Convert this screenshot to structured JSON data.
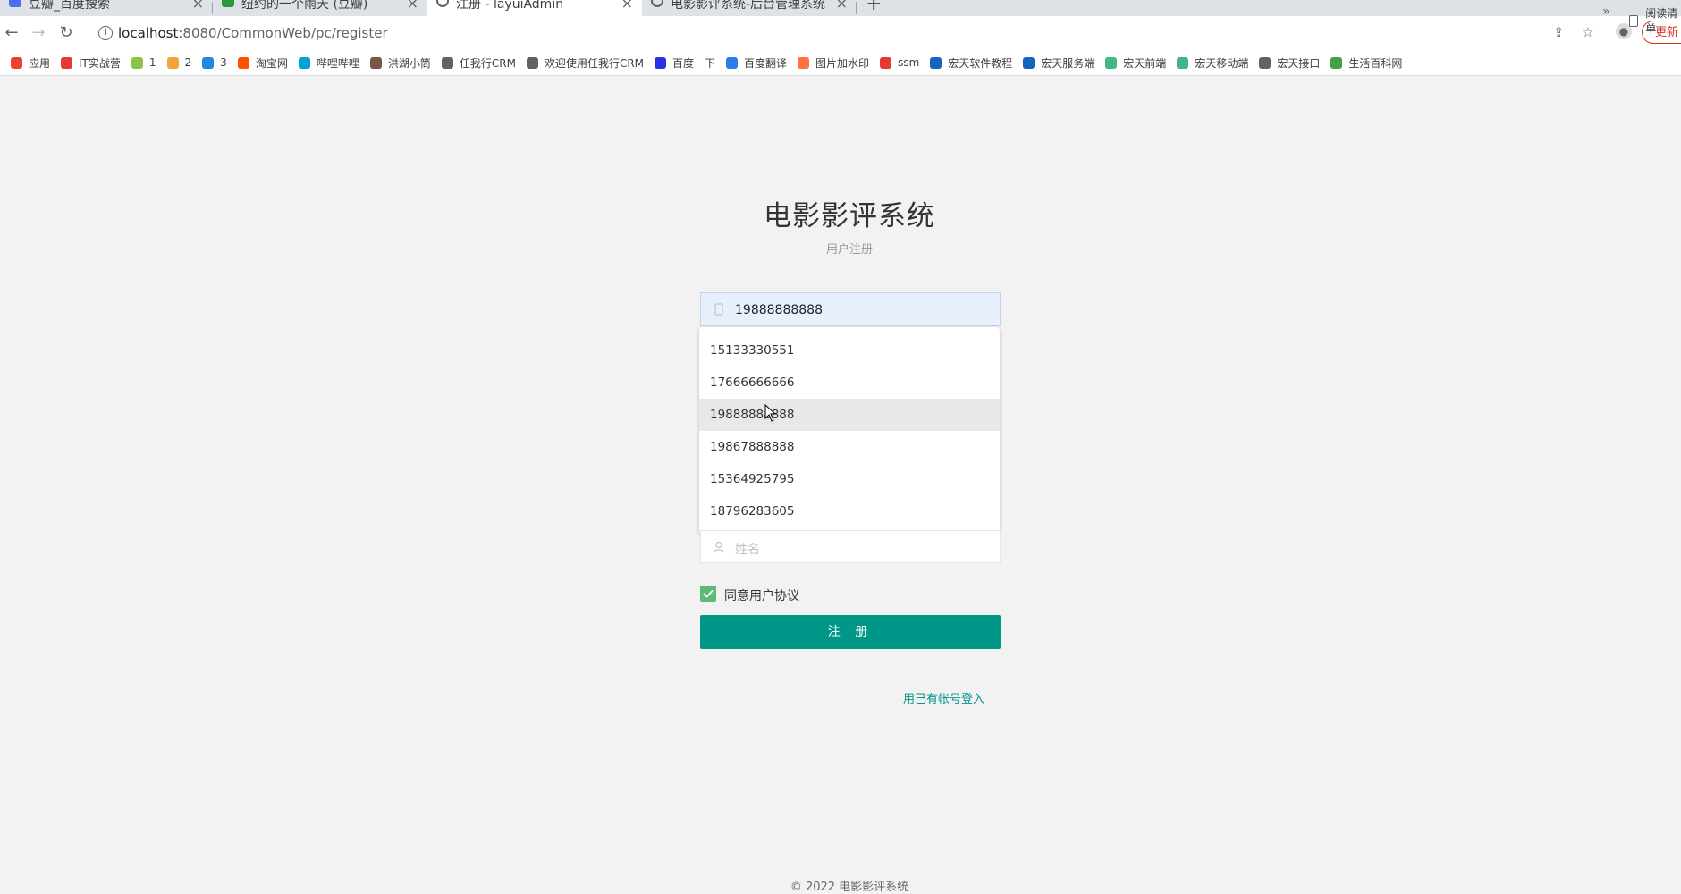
{
  "browser": {
    "tabs": [
      {
        "label": "豆瓣_百度搜索",
        "icon": "baidu-icon"
      },
      {
        "label": "纽约的一个雨天 (豆瓣)",
        "icon": "douban-icon"
      },
      {
        "label": "注册 - layuiAdmin",
        "icon": "globe-icon",
        "active": true
      },
      {
        "label": "电影影评系统-后台管理系统",
        "icon": "globe-icon"
      }
    ],
    "url_host": "localhost",
    "url_rest": ":8080/CommonWeb/pc/register",
    "update_label": "更新",
    "bookmarks": [
      {
        "label": "应用",
        "icon": "apps-grid-icon",
        "color": "#ea4335"
      },
      {
        "label": "IT实战营",
        "icon": "it-icon",
        "color": "#e53935"
      },
      {
        "label": "1",
        "icon": "cloud-icon",
        "color": "#8bc34a"
      },
      {
        "label": "2",
        "icon": "cat-icon",
        "color": "#f2a33a"
      },
      {
        "label": "3",
        "icon": "fish-icon",
        "color": "#1e88e5"
      },
      {
        "label": "淘宝网",
        "icon": "taobao-icon",
        "color": "#ff5000"
      },
      {
        "label": "哔哩哔哩",
        "icon": "bilibili-icon",
        "color": "#00a1d6"
      },
      {
        "label": "洪湖小筒",
        "icon": "feather-icon",
        "color": "#795548"
      },
      {
        "label": "任我行CRM",
        "icon": "globe-icon",
        "color": "#5f6368"
      },
      {
        "label": "欢迎使用任我行CRM",
        "icon": "globe-icon",
        "color": "#5f6368"
      },
      {
        "label": "百度一下",
        "icon": "baidu-icon",
        "color": "#2932e1"
      },
      {
        "label": "百度翻译",
        "icon": "translate-icon",
        "color": "#2b7de9"
      },
      {
        "label": "图片加水印",
        "icon": "image-icon",
        "color": "#ff7043"
      },
      {
        "label": "ssm",
        "icon": "g-icon",
        "color": "#e53935"
      },
      {
        "label": "宏天软件教程",
        "icon": "h-icon",
        "color": "#1565c0"
      },
      {
        "label": "宏天服务端",
        "icon": "h-icon",
        "color": "#1565c0"
      },
      {
        "label": "宏天前端",
        "icon": "vue-icon",
        "color": "#41b883"
      },
      {
        "label": "宏天移动端",
        "icon": "vue-icon",
        "color": "#41b883"
      },
      {
        "label": "宏天接口",
        "icon": "globe-icon",
        "color": "#5f6368"
      },
      {
        "label": "生活百科网",
        "icon": "book-icon",
        "color": "#43a047"
      }
    ],
    "reading_list_label": "阅读清单"
  },
  "page": {
    "title": "电影影评系统",
    "subtitle": "用户注册",
    "phone_value": "19888888888",
    "name_placeholder": "姓名",
    "autocomplete": [
      "15133330551",
      "17666666666",
      "19888888888",
      "19867888888",
      "15364925795",
      "18796283605"
    ],
    "agree_label": "同意用户协议",
    "submit_label": "注 册",
    "login_link": "用已有帐号登入",
    "footer": "© 2022 电影影评系统"
  }
}
